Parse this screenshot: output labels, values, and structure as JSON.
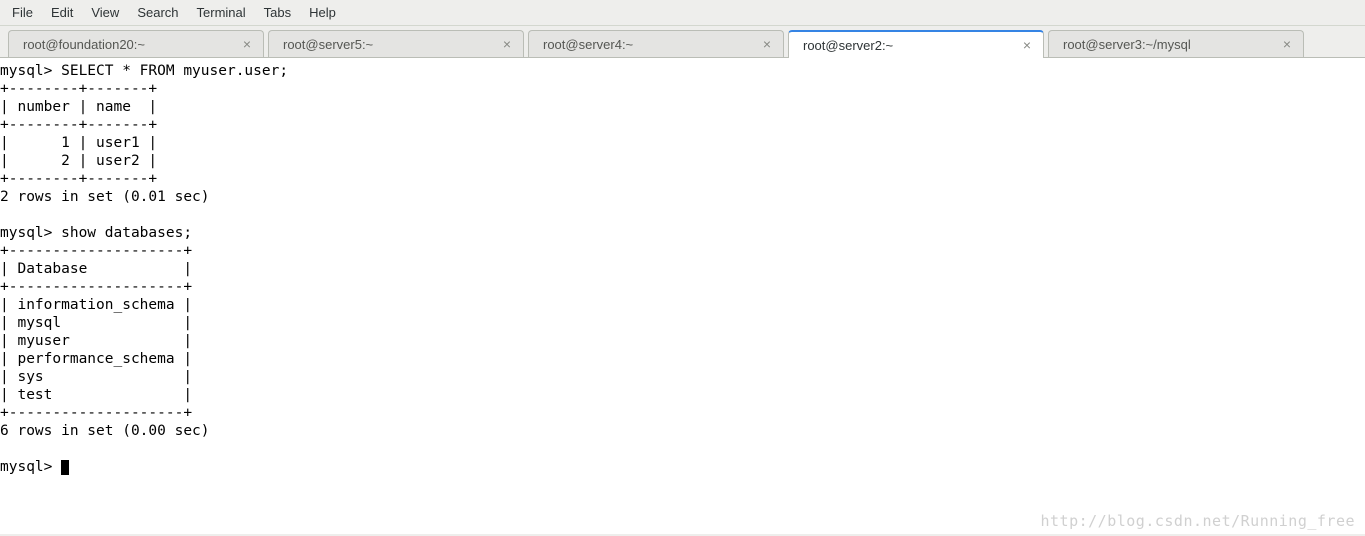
{
  "menu": {
    "items": [
      "File",
      "Edit",
      "View",
      "Search",
      "Terminal",
      "Tabs",
      "Help"
    ]
  },
  "tabs": [
    {
      "label": "root@foundation20:~",
      "active": false
    },
    {
      "label": "root@server5:~",
      "active": false
    },
    {
      "label": "root@server4:~",
      "active": false
    },
    {
      "label": "root@server2:~",
      "active": true
    },
    {
      "label": "root@server3:~/mysql",
      "active": false
    }
  ],
  "terminal": {
    "lines": [
      "mysql> SELECT * FROM myuser.user;",
      "+--------+-------+",
      "| number | name  |",
      "+--------+-------+",
      "|      1 | user1 |",
      "|      2 | user2 |",
      "+--------+-------+",
      "2 rows in set (0.01 sec)",
      "",
      "mysql> show databases;",
      "+--------------------+",
      "| Database           |",
      "+--------------------+",
      "| information_schema |",
      "| mysql              |",
      "| myuser             |",
      "| performance_schema |",
      "| sys                |",
      "| test               |",
      "+--------------------+",
      "6 rows in set (0.00 sec)",
      "",
      "mysql> "
    ],
    "prompt_cursor": true
  },
  "watermark": "http://blog.csdn.net/Running_free"
}
